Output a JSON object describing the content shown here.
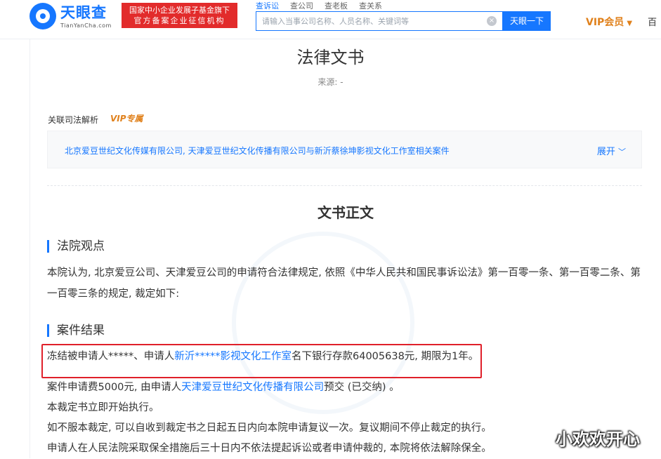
{
  "header": {
    "logo_cn": "天眼查",
    "logo_en": "TianYanCha.com",
    "badge_line1": "国家中小企业发展子基金旗下",
    "badge_line2": "官方备案企业征信机构",
    "tabs": [
      {
        "label": "查诉讼"
      },
      {
        "label": "查公司"
      },
      {
        "label": "查老板"
      },
      {
        "label": "查关系"
      }
    ],
    "search_placeholder": "请输入当事公司名称、人员名称、关键词等",
    "search_button": "天眼一下",
    "vip_label": "VIP会员",
    "more_label": "百"
  },
  "document": {
    "title": "法律文书",
    "source": "来源: -",
    "related_label": "关联司法解析",
    "vip_tag": "VIP专属",
    "related_case": "北京爱豆世纪文化传媒有限公司, 天津爱豆世纪文化传播有限公司与新沂蔡徐坤影视文化工作室相关案件",
    "expand_label": "展开",
    "section_title": "文书正文",
    "court_view_heading": "法院观点",
    "court_view_line1": "本院认为, 北京爱豆公司、天津爱豆公司的申请符合法律规定, 依照《中华人民共和国民事诉讼法》第一百零一条、第一百零二条、第",
    "court_view_line2": "一百零三条的规定, 裁定如下:",
    "result_heading": "案件结果",
    "result_p1_pre": "冻结被申请人*****、申请人",
    "result_p1_link": "新沂*****影视文化工作室",
    "result_p1_post": "名下银行存款64005638元, 期限为1年。",
    "result_p2_pre": "案件申请费5000元, 由申请人",
    "result_p2_link": "天津爱豆世纪文化传播有限公司",
    "result_p2_post": "预交 (已交纳) 。",
    "result_p3": "本裁定书立即开始执行。",
    "result_p4": "如不服本裁定, 可以自收到裁定书之日起五日内向本院申请复议一次。复议期间不停止裁定的执行。",
    "result_p5": "申请人在人民法院采取保全措施后三十日内不依法提起诉讼或者申请仲裁的, 本院将依法解除保全。"
  },
  "signature": "小欢欢开心",
  "colors": {
    "accent": "#1677ff",
    "vip": "#e0811c",
    "badge": "#e22b2b",
    "highlight": "#e0202a"
  }
}
